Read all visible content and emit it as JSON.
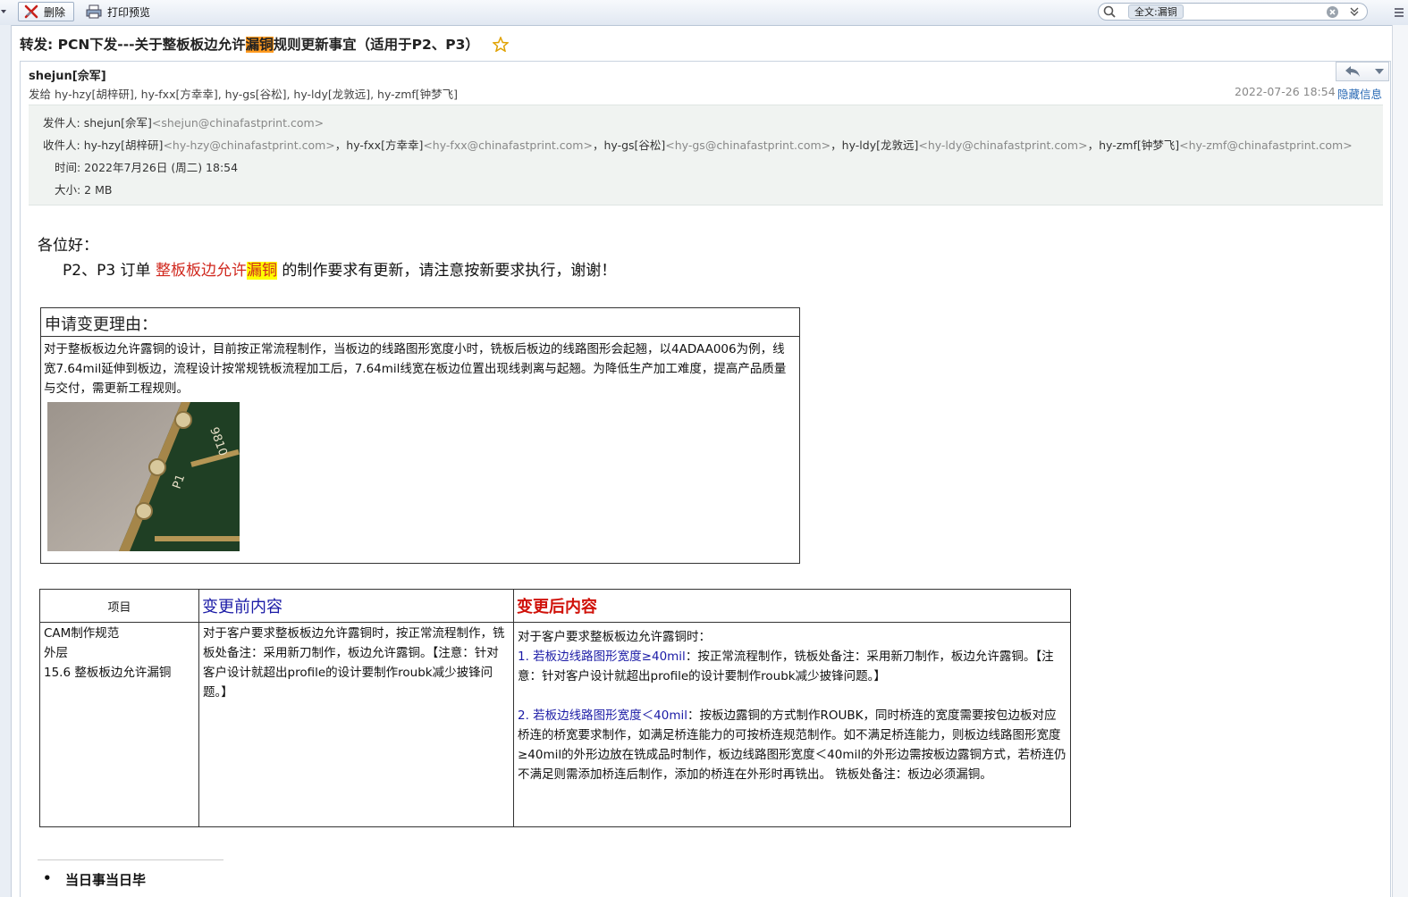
{
  "toolbar": {
    "delete_label": "删除",
    "print_preview_label": "打印预览",
    "search_tag": "全文:漏铜",
    "search_value": ""
  },
  "email": {
    "subject_prefix": "转发: PCN下发---关于整板板边允许",
    "subject_highlight": "漏铜",
    "subject_suffix": "规则更新事宜（适用于P2、P3）",
    "sender_name": "shejun[佘军]",
    "to_line": "发给 hy-hzy[胡梓研], hy-fxx[方幸幸], hy-gs[谷松], hy-ldy[龙敦远], hy-zmf[钟梦飞]",
    "date": "2022-07-26 18:54",
    "hide_info": "隐藏信息",
    "details": {
      "from_label": "发件人: ",
      "from_name": "shejun[佘军]",
      "from_email": "<shejun@chinafastprint.com>",
      "to_label": "收件人: ",
      "recipients": [
        {
          "name": "hy-hzy[胡梓研]",
          "email": "<hy-hzy@chinafastprint.com>"
        },
        {
          "name": "hy-fxx[方幸幸]",
          "email": "<hy-fxx@chinafastprint.com>"
        },
        {
          "name": "hy-gs[谷松]",
          "email": "<hy-gs@chinafastprint.com>"
        },
        {
          "name": "hy-ldy[龙敦远]",
          "email": "<hy-ldy@chinafastprint.com>"
        },
        {
          "name": "hy-zmf[钟梦飞]",
          "email": "<hy-zmf@chinafastprint.com>"
        }
      ],
      "separator": "，",
      "time_line": "时间: 2022年7月26日 (周二) 18:54",
      "size_line": "大小: 2 MB"
    }
  },
  "body": {
    "greeting": "各位好：",
    "notice_prefix": "P2、P3 订单 ",
    "notice_red": "整板板边允许",
    "notice_highlight": "漏铜",
    "notice_suffix": " 的制作要求有更新，请注意按新要求执行，谢谢！",
    "reason_title": "申请变更理由：",
    "reason_text": "对于整板板边允许露铜的设计，目前按正常流程制作，当板边的线路图形宽度小时，铣板后板边的线路图形会起翘，以4ADAA006为例，线宽7.64mil延伸到板边，流程设计按常规铣板流程加工后，7.64mil线宽在板边位置出现线剥离与起翘。为降低生产加工难度，提高产品质量与交付，需更新工程规则。",
    "pcb_labels": [
      "9810",
      "P1"
    ],
    "table": {
      "header_item": "项目",
      "header_before": "变更前内容",
      "header_after": "变更后内容",
      "item_lines": [
        "CAM制作规范",
        "外层",
        "15.6 整板板边允许漏铜"
      ],
      "before_text": "对于客户要求整板板边允许露铜时，按正常流程制作，铣板处备注：采用新刀制作，板边允许露铜。【注意：针对客户设计就超出profile的设计要制作roubk减少披锋问题。】",
      "after_intro": "对于客户要求整板板边允许露铜时：",
      "after_1_head": "1. 若板边线路图形宽度≥40mil",
      "after_1_text": "：按正常流程制作，铣板处备注：采用新刀制作，板边允许露铜。【注意：针对客户设计就超出profile的设计要制作roubk减少披锋问题。】",
      "after_2_head": "2. 若板边线路图形宽度＜40mil",
      "after_2_text": "：按板边露铜的方式制作ROUBK，同时桥连的宽度需要按包边板对应桥连的桥宽要求制作，如满足桥连能力的可按桥连规范制作。如不满足桥连能力，则板边线路图形宽度≥40mil的外形边放在铣成品时制作，板边线路图形宽度＜40mil的外形边需按板边露铜方式，若桥连仍不满足则需添加桥连后制作，添加的桥连在外形时再铣出。 铣板处备注：板边必须漏铜。"
    },
    "bullet": "当日事当日毕"
  },
  "colors": {
    "accent_blue": "#1a1aa6",
    "accent_red": "#d0120a",
    "highlight_yellow": "#ffff00",
    "highlight_orange": "#ff9a1f"
  }
}
